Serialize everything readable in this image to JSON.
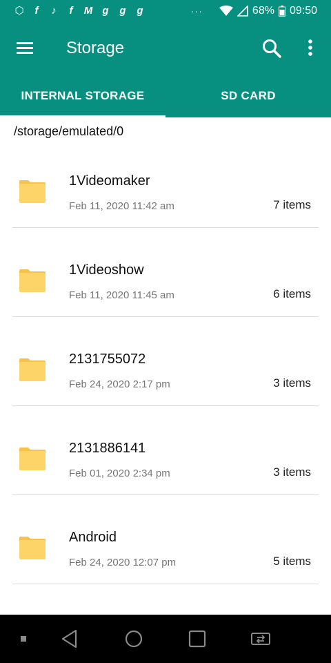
{
  "status_bar": {
    "notification_icons": [
      "vpn-icon",
      "facebook-icon",
      "tiktok-icon",
      "facebook-icon",
      "m-app-icon",
      "g-app-icon",
      "g-app-icon",
      "g-app-icon"
    ],
    "notification_glyphs": [
      "⬡",
      "f",
      "♪",
      "f",
      "M",
      "g",
      "g",
      "g"
    ],
    "overflow": "···",
    "battery": "68%",
    "time": "09:50"
  },
  "app_bar": {
    "title": "Storage"
  },
  "tabs": [
    {
      "label": "INTERNAL STORAGE",
      "selected": true
    },
    {
      "label": "SD CARD",
      "selected": false
    }
  ],
  "path": "/storage/emulated/0",
  "files": [
    {
      "name": "1Videomaker",
      "date": "Feb 11, 2020 11:42 am",
      "count": "7 items"
    },
    {
      "name": "1Videoshow",
      "date": "Feb 11, 2020 11:45 am",
      "count": "6 items"
    },
    {
      "name": "2131755072",
      "date": "Feb 24, 2020 2:17 pm",
      "count": "3 items"
    },
    {
      "name": "2131886141",
      "date": "Feb 01, 2020 2:34 pm",
      "count": "3 items"
    },
    {
      "name": "Android",
      "date": "Feb 24, 2020 12:07 pm",
      "count": "5 items"
    }
  ],
  "colors": {
    "primary": "#078f7f",
    "folder": "#fdd468",
    "folder_tab": "#f4c24d"
  }
}
